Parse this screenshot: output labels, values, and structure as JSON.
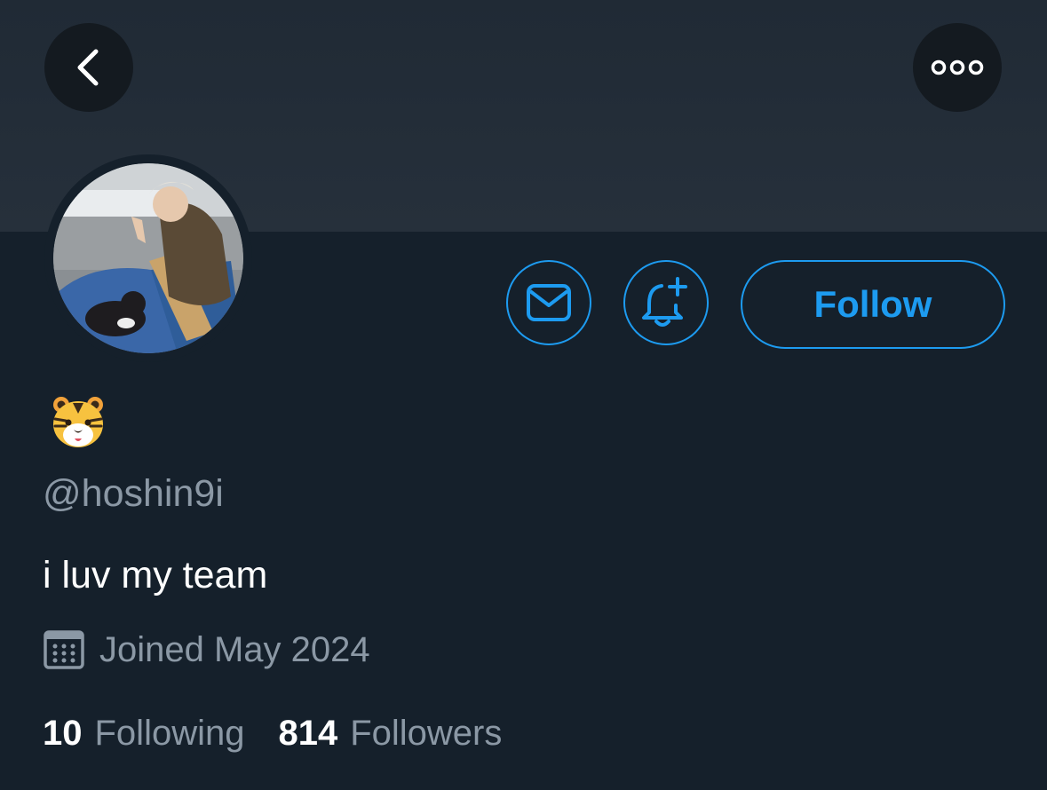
{
  "header": {
    "back_icon": "chevron-left-icon",
    "more_icon": "more-horizontal-icon"
  },
  "profile": {
    "avatar_icon": "avatar-photo",
    "name_emoji": "tiger-face-emoji",
    "handle": "@hoshin9i",
    "bio": "i luv my team",
    "joined": "Joined May 2024",
    "following_count": "10",
    "following_label": "Following",
    "followers_count": "814",
    "followers_label": "Followers"
  },
  "actions": {
    "message_icon": "envelope-icon",
    "notify_icon": "bell-plus-icon",
    "follow_label": "Follow"
  },
  "colors": {
    "background": "#15202b",
    "banner": "#232d38",
    "accent": "#1d9bf0",
    "secondary_text": "#8b98a5",
    "primary_text": "#ffffff"
  }
}
